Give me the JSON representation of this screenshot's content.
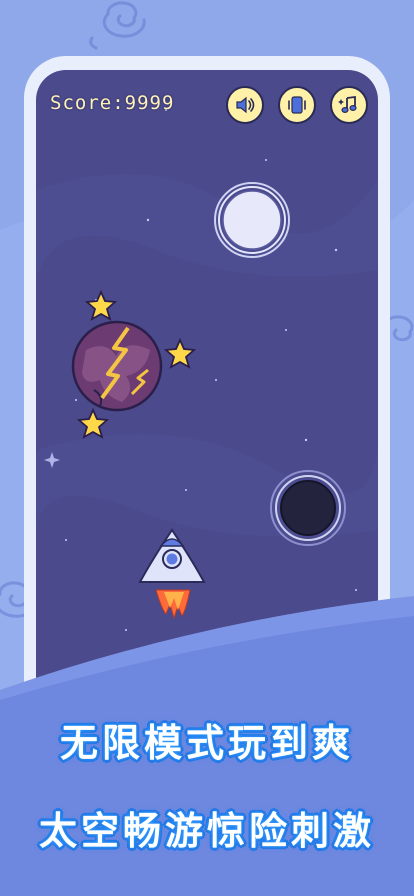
{
  "hud": {
    "score_label": "Score:9999",
    "sound_icon": "speaker-icon",
    "vibrate_icon": "vibrate-icon",
    "music_icon": "music-note-icon"
  },
  "promo": {
    "line1": "无限模式玩到爽",
    "line2": "太空畅游惊险刺激"
  },
  "game": {
    "objects": [
      "white-hole",
      "cracked-planet",
      "black-hole",
      "rocket"
    ],
    "stars_around_planet": 3
  },
  "colors": {
    "space": "#4a4a8c",
    "hud_button": "#fff2a8",
    "slogan_outline": "#1f6fe0",
    "background": "#8fa8ea"
  }
}
